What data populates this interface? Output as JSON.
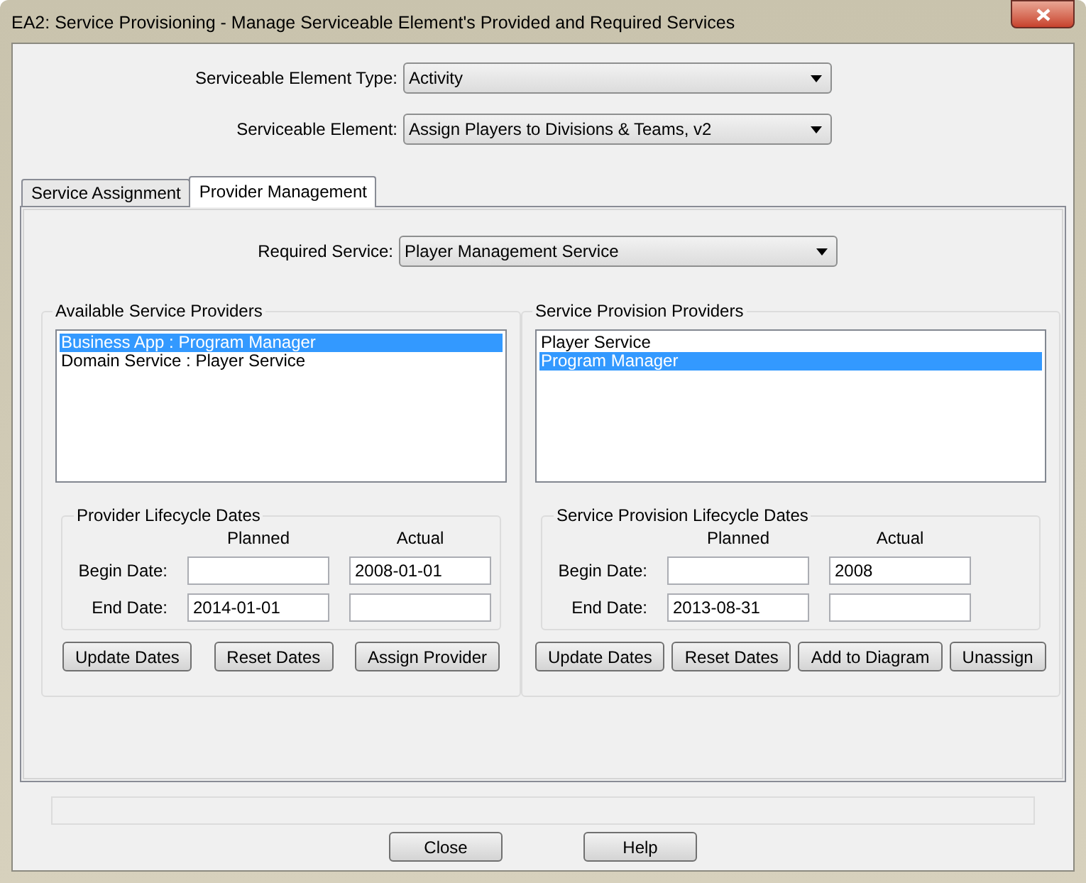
{
  "window": {
    "title": "EA2: Service Provisioning - Manage Serviceable Element's Provided and Required Services"
  },
  "selectors": [
    {
      "label": "Serviceable Element Type:",
      "value": "Activity"
    },
    {
      "label": "Serviceable Element:",
      "value": "Assign Players to Divisions & Teams, v2"
    }
  ],
  "tabs": [
    {
      "label": "Service Assignment",
      "selected": false
    },
    {
      "label": "Provider Management",
      "selected": true
    }
  ],
  "required_service": {
    "label": "Required Service:",
    "value": "Player Management Service"
  },
  "panels": [
    {
      "title": "Available Service Providers",
      "items": [
        {
          "label": "Business App : Program Manager",
          "selected": true
        },
        {
          "label": "Domain Service : Player Service",
          "selected": false
        }
      ],
      "dates": {
        "title": "Provider Lifecycle Dates",
        "columns": [
          "Planned",
          "Actual"
        ],
        "rows": [
          {
            "label": "Begin Date:",
            "actual": "2008-01-01"
          },
          {
            "label": "End Date:",
            "planned": "2014-01-01"
          }
        ]
      },
      "buttons": [
        "Update Dates",
        "Reset Dates",
        "Assign Provider"
      ]
    },
    {
      "title": "Service Provision Providers",
      "items": [
        {
          "label": "Player Service",
          "selected": false
        },
        {
          "label": "Program Manager",
          "selected": true
        }
      ],
      "dates": {
        "title": "Service Provision Lifecycle Dates",
        "columns": [
          "Planned",
          "Actual"
        ],
        "rows": [
          {
            "label": "Begin Date:",
            "actual": "2008"
          },
          {
            "label": "End Date:",
            "planned": "2013-08-31"
          }
        ]
      },
      "buttons": [
        "Update Dates",
        "Reset Dates",
        "Add to Diagram",
        "Unassign"
      ]
    }
  ],
  "footer_buttons": [
    "Close",
    "Help"
  ]
}
